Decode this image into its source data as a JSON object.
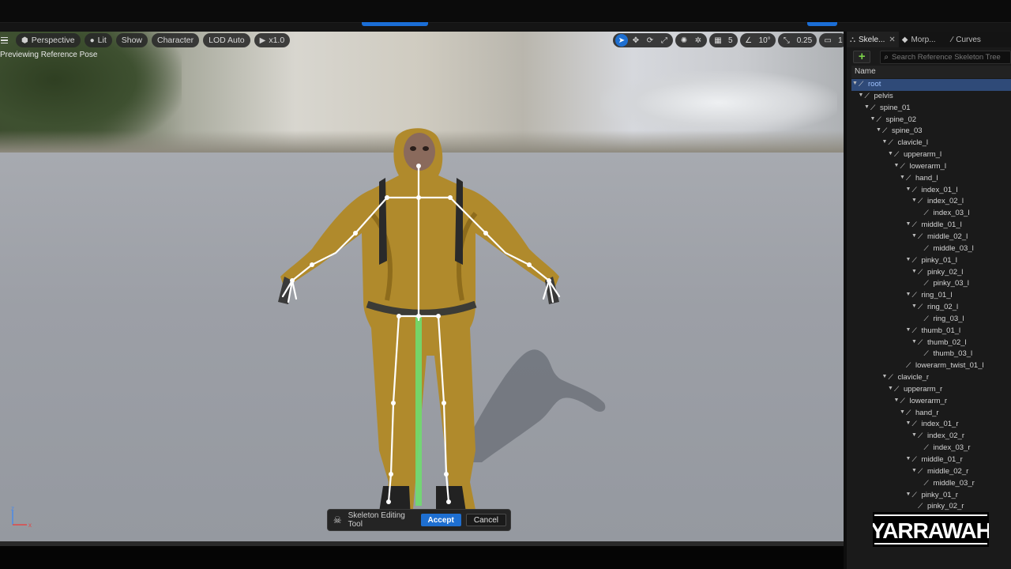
{
  "viewport": {
    "menu_icon": "hamburger-icon",
    "perspective": "Perspective",
    "lit": "Lit",
    "show": "Show",
    "character": "Character",
    "lod": "LOD Auto",
    "speed": "x1.0",
    "preview_text": "Previewing Reference Pose",
    "grid_value": "5",
    "angle_value": "10°",
    "scale_value": "0.25",
    "camera_value": "1"
  },
  "skeleton_tool": {
    "label": "Skeleton Editing Tool",
    "accept": "Accept",
    "cancel": "Cancel"
  },
  "panel": {
    "tabs": [
      {
        "label": "Skele...",
        "icon": "skeleton-tree-icon",
        "closable": true
      },
      {
        "label": "Morp...",
        "icon": "morph-target-icon",
        "closable": false
      },
      {
        "label": "Curves",
        "icon": "curve-icon",
        "closable": false
      }
    ],
    "search_placeholder": "Search Reference Skeleton Tree",
    "column_name": "Name",
    "bones": [
      {
        "name": "root",
        "depth": 0,
        "selected": true
      },
      {
        "name": "pelvis",
        "depth": 1
      },
      {
        "name": "spine_01",
        "depth": 2
      },
      {
        "name": "spine_02",
        "depth": 3
      },
      {
        "name": "spine_03",
        "depth": 4
      },
      {
        "name": "clavicle_l",
        "depth": 5
      },
      {
        "name": "upperarm_l",
        "depth": 6
      },
      {
        "name": "lowerarm_l",
        "depth": 7
      },
      {
        "name": "hand_l",
        "depth": 8
      },
      {
        "name": "index_01_l",
        "depth": 9
      },
      {
        "name": "index_02_l",
        "depth": 10
      },
      {
        "name": "index_03_l",
        "depth": 11
      },
      {
        "name": "middle_01_l",
        "depth": 9
      },
      {
        "name": "middle_02_l",
        "depth": 10
      },
      {
        "name": "middle_03_l",
        "depth": 11
      },
      {
        "name": "pinky_01_l",
        "depth": 9
      },
      {
        "name": "pinky_02_l",
        "depth": 10
      },
      {
        "name": "pinky_03_l",
        "depth": 11
      },
      {
        "name": "ring_01_l",
        "depth": 9
      },
      {
        "name": "ring_02_l",
        "depth": 10
      },
      {
        "name": "ring_03_l",
        "depth": 11
      },
      {
        "name": "thumb_01_l",
        "depth": 9
      },
      {
        "name": "thumb_02_l",
        "depth": 10
      },
      {
        "name": "thumb_03_l",
        "depth": 11
      },
      {
        "name": "lowerarm_twist_01_l",
        "depth": 8
      },
      {
        "name": "clavicle_r",
        "depth": 5
      },
      {
        "name": "upperarm_r",
        "depth": 6
      },
      {
        "name": "lowerarm_r",
        "depth": 7
      },
      {
        "name": "hand_r",
        "depth": 8
      },
      {
        "name": "index_01_r",
        "depth": 9
      },
      {
        "name": "index_02_r",
        "depth": 10
      },
      {
        "name": "index_03_r",
        "depth": 11
      },
      {
        "name": "middle_01_r",
        "depth": 9
      },
      {
        "name": "middle_02_r",
        "depth": 10
      },
      {
        "name": "middle_03_r",
        "depth": 11
      },
      {
        "name": "pinky_01_r",
        "depth": 9
      },
      {
        "name": "pinky_02_r",
        "depth": 10
      }
    ]
  },
  "watermark": {
    "text": "YARRAWAH"
  },
  "colors": {
    "accent": "#1e6fd1",
    "selection": "#2f4a78",
    "add_green": "#7cd14a"
  }
}
